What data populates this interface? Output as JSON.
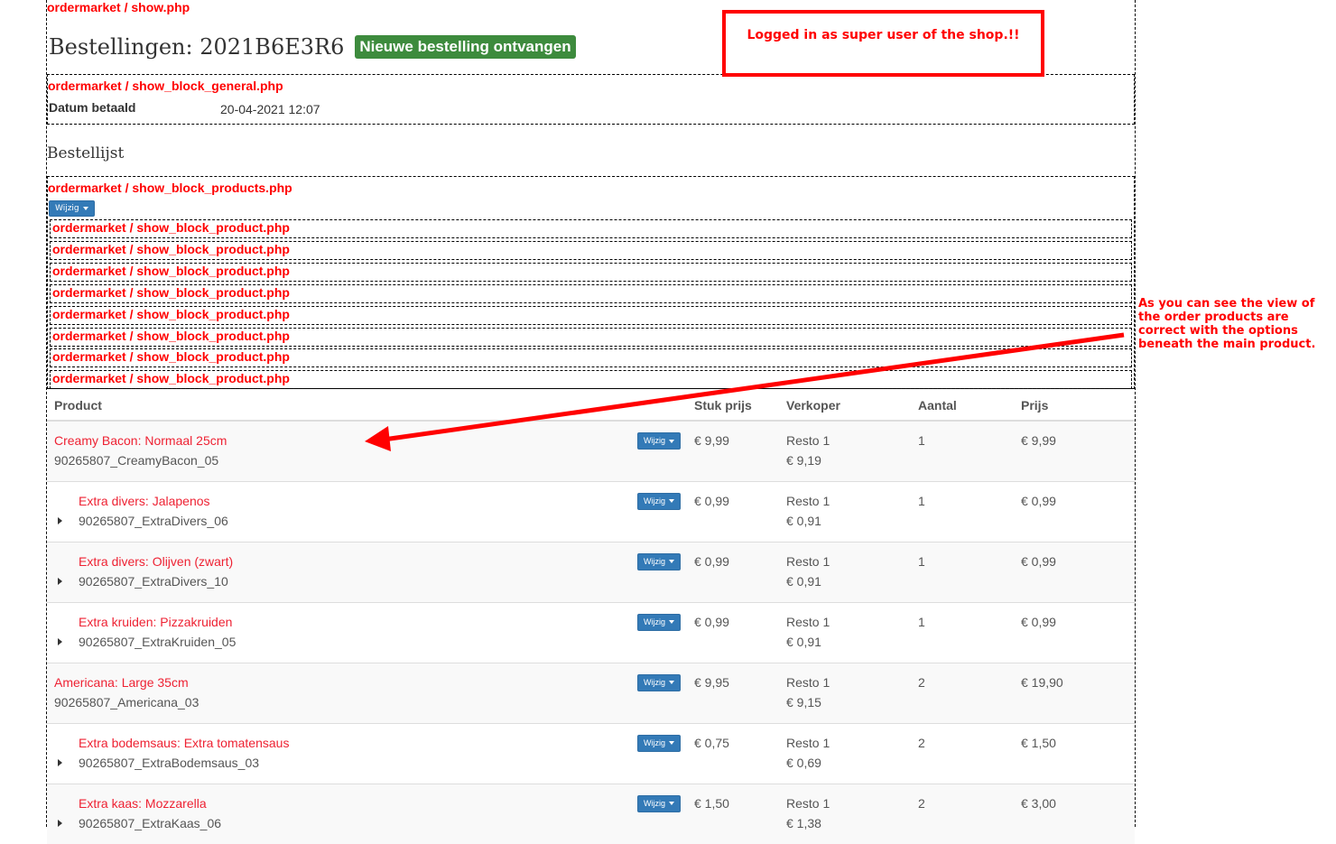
{
  "debug": {
    "show": "ordermarket / show.php",
    "general": "ordermarket / show_block_general.php",
    "products": "ordermarket / show_block_products.php",
    "product": "ordermarket / show_block_product.php"
  },
  "header": {
    "title": "Bestellingen: 2021B6E3R6",
    "badge": "Nieuwe bestelling ontvangen"
  },
  "general": {
    "label": "Datum betaald",
    "value": "20-04-2021 12:07"
  },
  "section_title": "Bestellijst",
  "wijzig_label": "Wijzig",
  "product_blocks": 8,
  "table": {
    "headers": [
      "Product",
      "Stuk prijs",
      "Verkoper",
      "Aantal",
      "Prijs"
    ],
    "rows": [
      {
        "name": "Creamy Bacon: Normaal 25cm",
        "sku": "90265807_CreamyBacon_05",
        "price": "€ 9,99",
        "seller": "Resto 1",
        "seller_price": "€ 9,19",
        "qty": "1",
        "total": "€ 9,99",
        "sub": false
      },
      {
        "name": "Extra divers: Jalapenos",
        "sku": "90265807_ExtraDivers_06",
        "price": "€ 0,99",
        "seller": "Resto 1",
        "seller_price": "€ 0,91",
        "qty": "1",
        "total": "€ 0,99",
        "sub": true
      },
      {
        "name": "Extra divers: Olijven (zwart)",
        "sku": "90265807_ExtraDivers_10",
        "price": "€ 0,99",
        "seller": "Resto 1",
        "seller_price": "€ 0,91",
        "qty": "1",
        "total": "€ 0,99",
        "sub": true
      },
      {
        "name": "Extra kruiden: Pizzakruiden",
        "sku": "90265807_ExtraKruiden_05",
        "price": "€ 0,99",
        "seller": "Resto 1",
        "seller_price": "€ 0,91",
        "qty": "1",
        "total": "€ 0,99",
        "sub": true
      },
      {
        "name": "Americana: Large 35cm",
        "sku": "90265807_Americana_03",
        "price": "€ 9,95",
        "seller": "Resto 1",
        "seller_price": "€ 9,15",
        "qty": "2",
        "total": "€ 19,90",
        "sub": false
      },
      {
        "name": "Extra bodemsaus: Extra tomatensaus",
        "sku": "90265807_ExtraBodemsaus_03",
        "price": "€ 0,75",
        "seller": "Resto 1",
        "seller_price": "€ 0,69",
        "qty": "2",
        "total": "€ 1,50",
        "sub": true
      },
      {
        "name": "Extra kaas: Mozzarella",
        "sku": "90265807_ExtraKaas_06",
        "price": "€ 1,50",
        "seller": "Resto 1",
        "seller_price": "€ 1,38",
        "qty": "2",
        "total": "€ 3,00",
        "sub": true
      }
    ]
  },
  "annotations": {
    "box": "Logged in as super user of the shop.!!",
    "side": "As you can see the view of the order products are correct with the options beneath the main product."
  },
  "colors": {
    "debug": "#ff0000",
    "badge": "#3d8b3d",
    "button": "#337ab7"
  }
}
